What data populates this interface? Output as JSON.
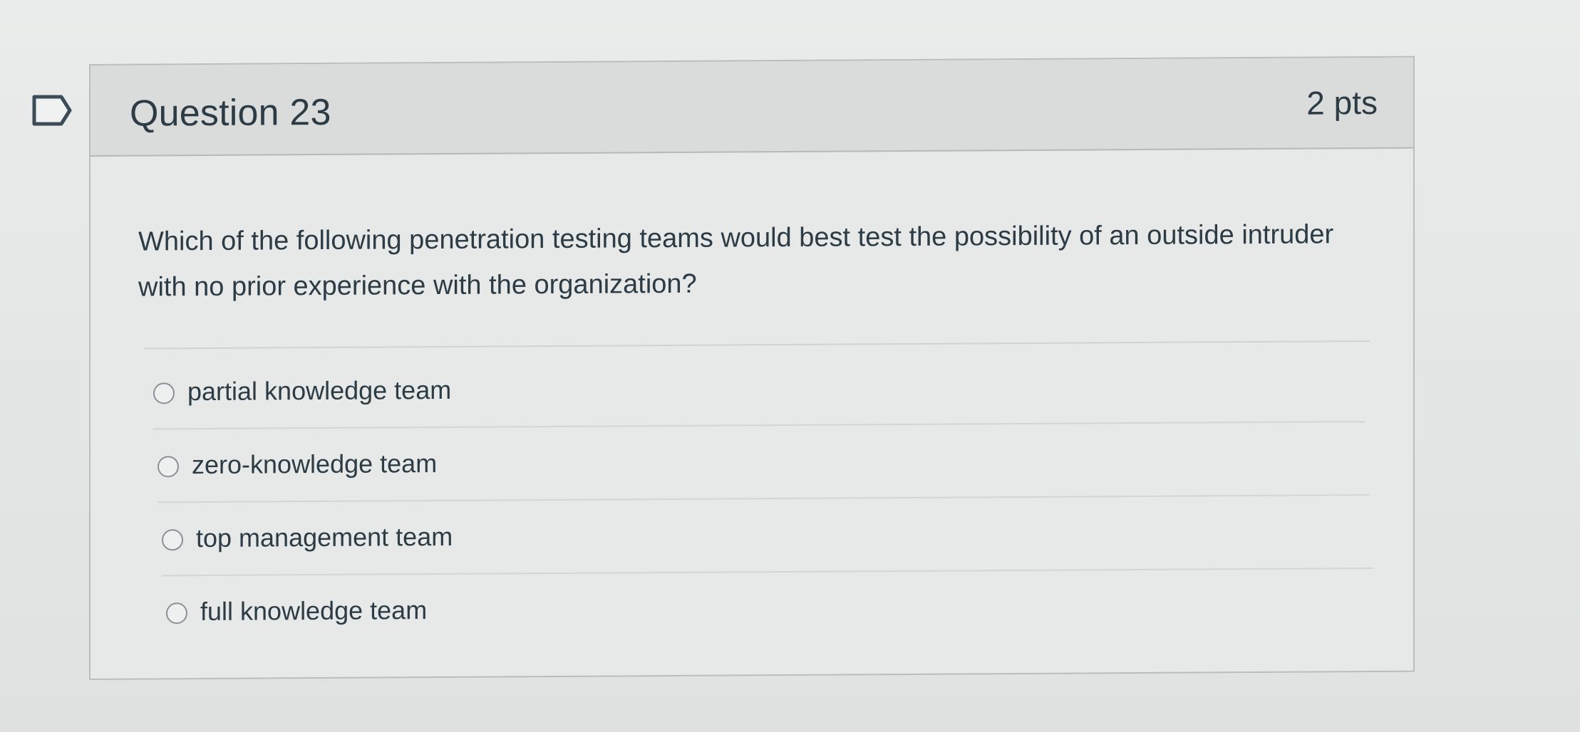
{
  "question": {
    "title": "Question 23",
    "points": "2 pts",
    "text": "Which of the following penetration testing teams would best test the possibility of an outside intruder with no prior experience with the organization?"
  },
  "answers": [
    {
      "label": "partial knowledge team",
      "selected": false
    },
    {
      "label": "zero-knowledge team",
      "selected": false
    },
    {
      "label": "top management team",
      "selected": false
    },
    {
      "label": "full knowledge team",
      "selected": false
    }
  ],
  "icons": {
    "flag": "flag-question-icon",
    "radio": "radio-unchecked-icon"
  },
  "colors": {
    "text": "#2d3b45",
    "header_bg": "#d9dcdb",
    "card_bg": "#e6e9e8",
    "border": "#b9bdbc"
  }
}
